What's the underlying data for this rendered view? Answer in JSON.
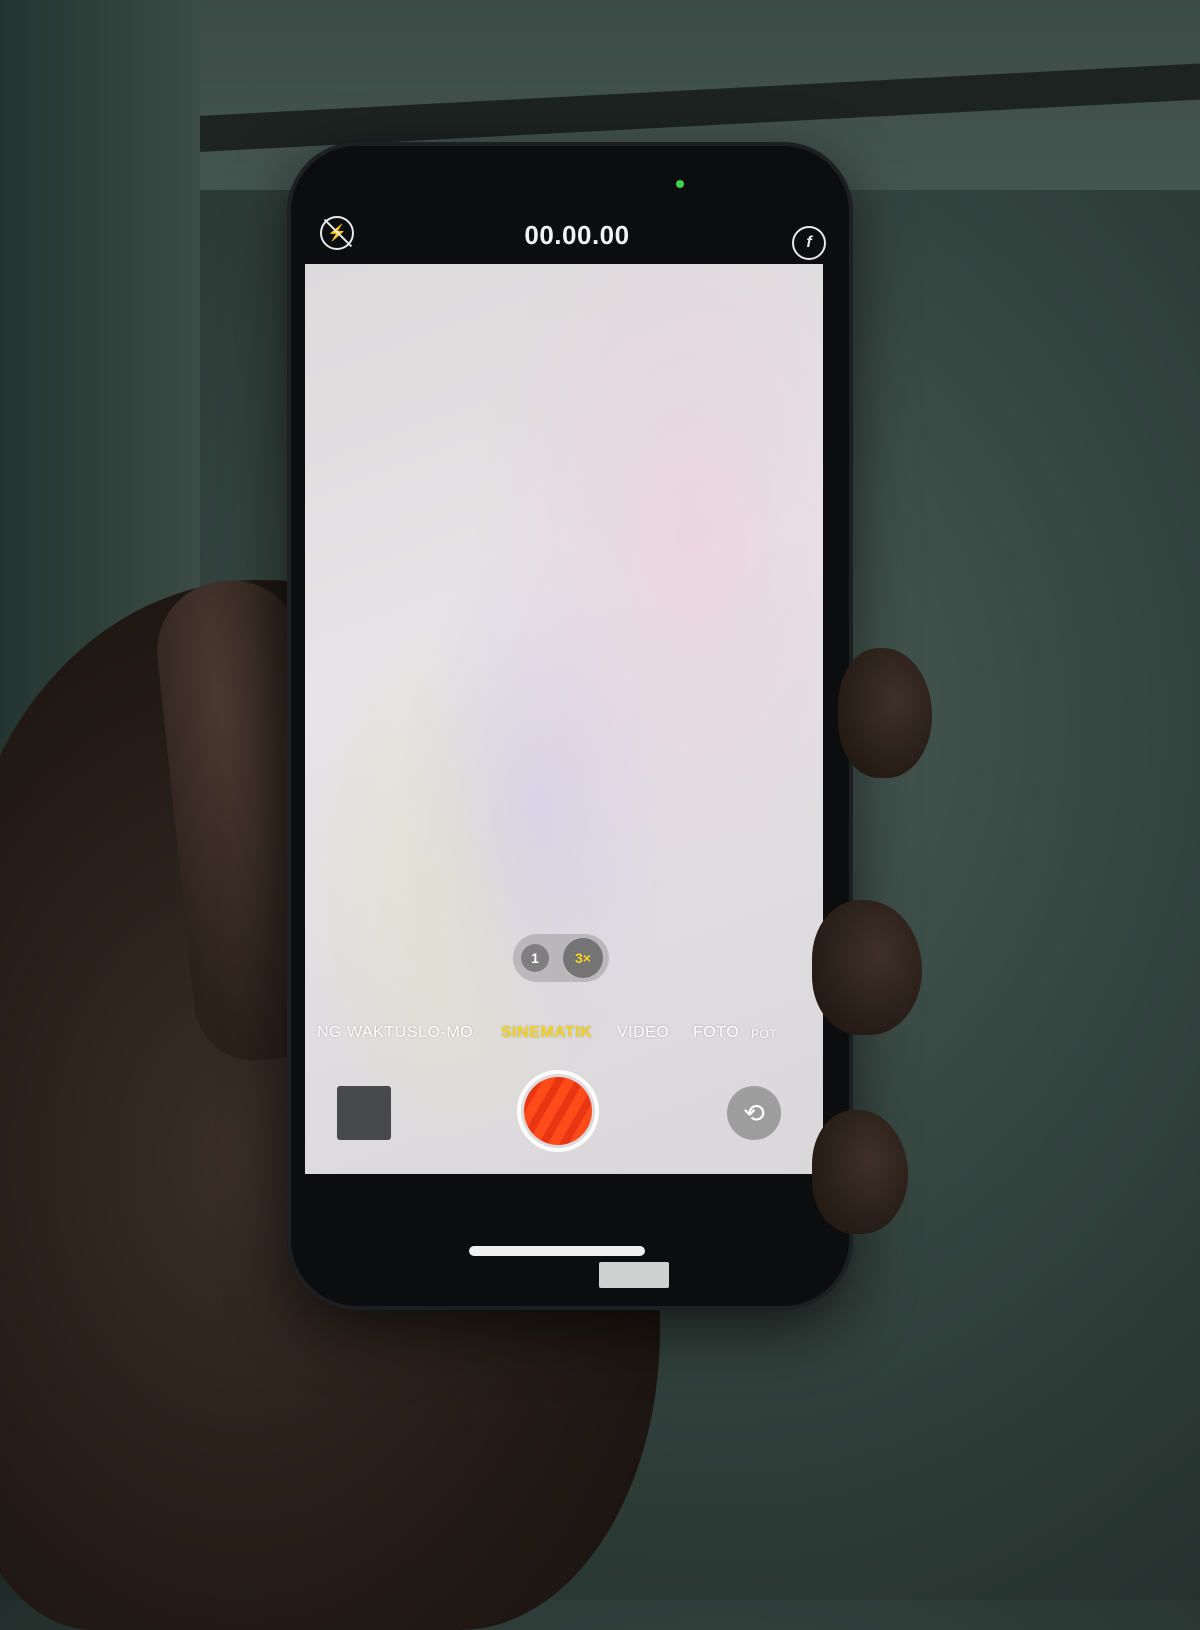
{
  "camera_app": {
    "status": {
      "timer": "00.00.00"
    },
    "icons": {
      "flash": "flash-off-icon",
      "format": "format-f-icon",
      "flip": "camera-flip-icon",
      "shutter": "record-icon"
    },
    "zoom": {
      "options": [
        "1",
        "3×"
      ],
      "selected": "3×"
    },
    "modes": [
      "NG WAKTU",
      "SLO-MO",
      "SINEMATIK",
      "VIDEO",
      "FOTO",
      "POT"
    ],
    "active_mode": "SINEMATIK",
    "colors": {
      "accent": "#f5d31e",
      "record": "#ff4a1a"
    }
  }
}
